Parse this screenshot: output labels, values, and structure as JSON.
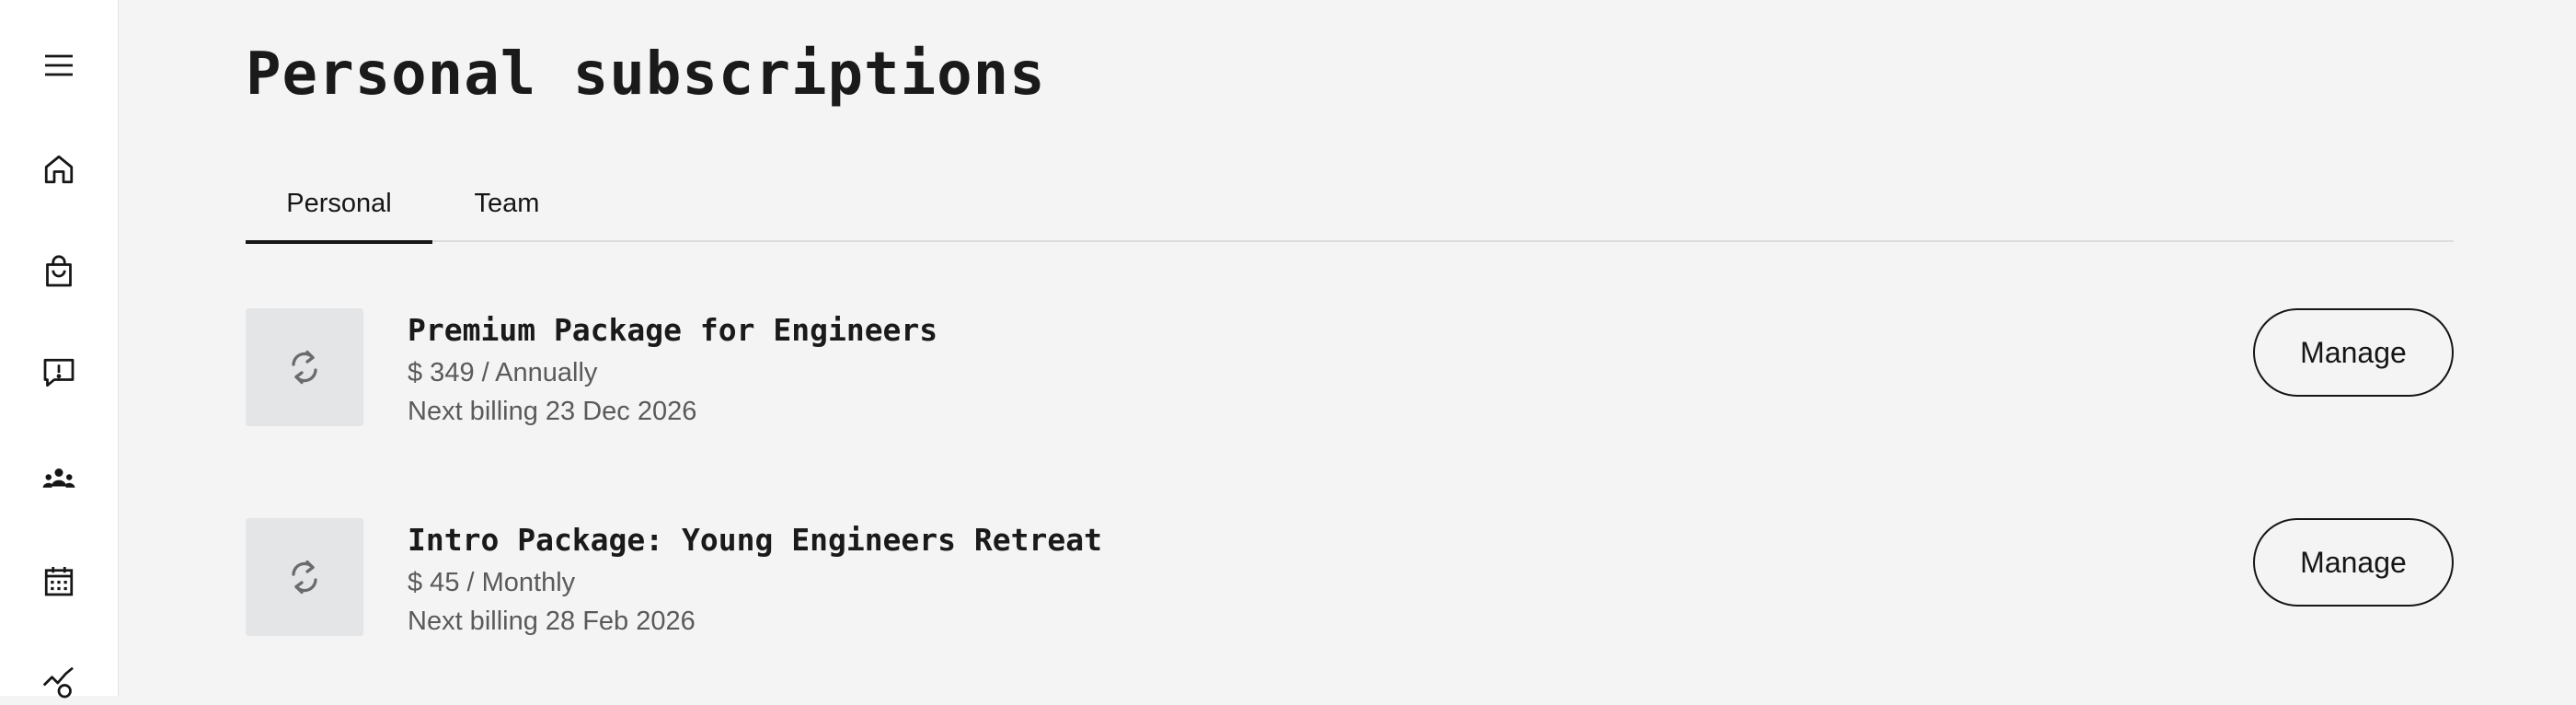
{
  "sidebar": {
    "items": [
      {
        "icon": "menu-icon"
      },
      {
        "icon": "home-icon"
      },
      {
        "icon": "shopping-bag-icon"
      },
      {
        "icon": "feedback-icon"
      },
      {
        "icon": "team-icon"
      },
      {
        "icon": "calendar-icon"
      },
      {
        "icon": "analytics-icon"
      }
    ]
  },
  "page": {
    "title": "Personal subscriptions"
  },
  "tabs": [
    {
      "label": "Personal",
      "active": true
    },
    {
      "label": "Team",
      "active": false
    }
  ],
  "subscriptions": [
    {
      "name": "Premium Package for Engineers",
      "price": "$ 349 / Annually",
      "billing": "Next billing 23 Dec 2026",
      "icon": "renew-icon",
      "action_label": "Manage"
    },
    {
      "name": "Intro Package: Young Engineers Retreat",
      "price": "$ 45 / Monthly",
      "billing": "Next billing 28 Feb 2026",
      "icon": "renew-icon",
      "action_label": "Manage"
    }
  ],
  "colors": {
    "background": "#f4f4f4",
    "sidebar_background": "#ffffff",
    "text_primary": "#161616",
    "text_secondary": "#5a5a5a",
    "thumbnail_background": "#e4e5e7"
  }
}
